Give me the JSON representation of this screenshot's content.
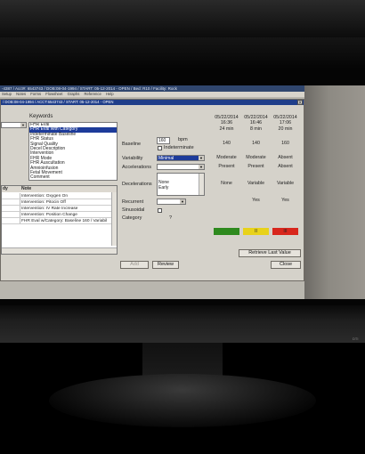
{
  "window": {
    "title": "-4387 / Acct#: 6543743 / DOB:08-04-1994 / START: 05-12-2014 - OPEN / Bed: R10 / Facility: Rock",
    "menu": [
      "Setup",
      "Notes",
      "Forms",
      "Flowsheet",
      "Graphs",
      "Reference",
      "Help"
    ]
  },
  "dialog": {
    "title": "/ DOB:08-04-1994 / ACCT:6543743 / START: 05-12-2014 - OPEN",
    "close_label": "X"
  },
  "keywords": {
    "header": "Keywords",
    "items": [
      "FHR Eval",
      "FHR Eval with Category",
      "Indeterminate Baseline",
      "FHR Status",
      "Signal Quality",
      "Decel Description",
      "Intervention",
      "FHR Mode",
      "FHR Auscultation",
      "Amnioinfusion",
      "Fetal Movement",
      "Comment"
    ],
    "selected_index": 1
  },
  "notes": {
    "col1": "dy",
    "col2": "Note",
    "rows": [
      "Intervention: Oxygen On",
      "Intervention: Pitocin Off",
      "Intervention: IV Rate Increase",
      "Intervention: Position Change",
      "FHR Eval w/Category: Baseline 160 / Variabil"
    ]
  },
  "form": {
    "baseline_label": "Baseline",
    "baseline_value": "160",
    "bpm_label": "bpm",
    "indeterminate_label": "Indeterminate",
    "variability_label": "Variability",
    "variability_value": "Minimal",
    "accelerations_label": "Accelerations",
    "decelerations_label": "Decelerations",
    "decel_options": [
      "None",
      "Early"
    ],
    "recurrent_label": "Recurrent",
    "sinusoidal_label": "Sinusoidal",
    "category_label": "Category",
    "category_value": "?"
  },
  "grid": {
    "columns": [
      {
        "date": "05/22/2014",
        "time": "16:36",
        "dur": "24 min",
        "baseline": "140",
        "variability": "Moderate",
        "accels": "Present",
        "decels": "None",
        "recurrent": ""
      },
      {
        "date": "05/22/2014",
        "time": "16:46",
        "dur": "8 min",
        "baseline": "140",
        "variability": "Moderate",
        "accels": "Present",
        "decels": "Variable",
        "recurrent": "Yes"
      },
      {
        "date": "05/22/2014",
        "time": "17:06",
        "dur": "20 min",
        "baseline": "160",
        "variability": "Absent",
        "accels": "Absent",
        "decels": "Variable",
        "recurrent": "Yes"
      }
    ],
    "severity": [
      {
        "label": "",
        "color": "#2e8a1e"
      },
      {
        "label": "II",
        "color": "#e8d21a"
      },
      {
        "label": "III",
        "color": "#d8261c"
      }
    ]
  },
  "buttons": {
    "retrieve": "Retrieve Last Value",
    "add": "Add",
    "review": "Review",
    "close": "Close"
  },
  "monitor": {
    "brand": "DTI"
  }
}
